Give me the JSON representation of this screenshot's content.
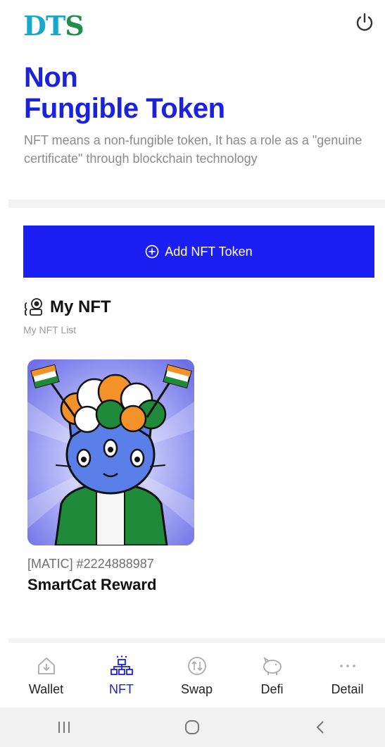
{
  "header": {
    "logo_part1": "DT",
    "logo_part2": "S",
    "power_icon": "power-icon"
  },
  "hero": {
    "title_line1": "Non",
    "title_line2": "Fungible Token",
    "description": "NFT means a non-fungible token, It has a role as a \"genuine certificate\" through blockchain technology"
  },
  "actions": {
    "add_nft_label": "Add NFT Token",
    "add_icon": "plus-circle-icon"
  },
  "section": {
    "title": "My NFT",
    "subtitle": "My NFT List",
    "icon": "nft-collection-icon"
  },
  "nfts": [
    {
      "meta": "[MATIC] #2224888987",
      "name": "SmartCat Reward",
      "image": "smartcat-nft-image"
    }
  ],
  "tabs": [
    {
      "label": "Wallet",
      "icon": "wallet-home-icon",
      "active": false
    },
    {
      "label": "NFT",
      "icon": "nft-network-icon",
      "active": true
    },
    {
      "label": "Swap",
      "icon": "swap-icon",
      "active": false
    },
    {
      "label": "Defi",
      "icon": "piggy-bank-icon",
      "active": false
    },
    {
      "label": "Detail",
      "icon": "more-dots-icon",
      "active": false
    }
  ],
  "colors": {
    "accent": "#1a22e0",
    "button": "#1b1ff2",
    "logo_blue": "#1aa8c8",
    "logo_green": "#1e8f4c"
  }
}
